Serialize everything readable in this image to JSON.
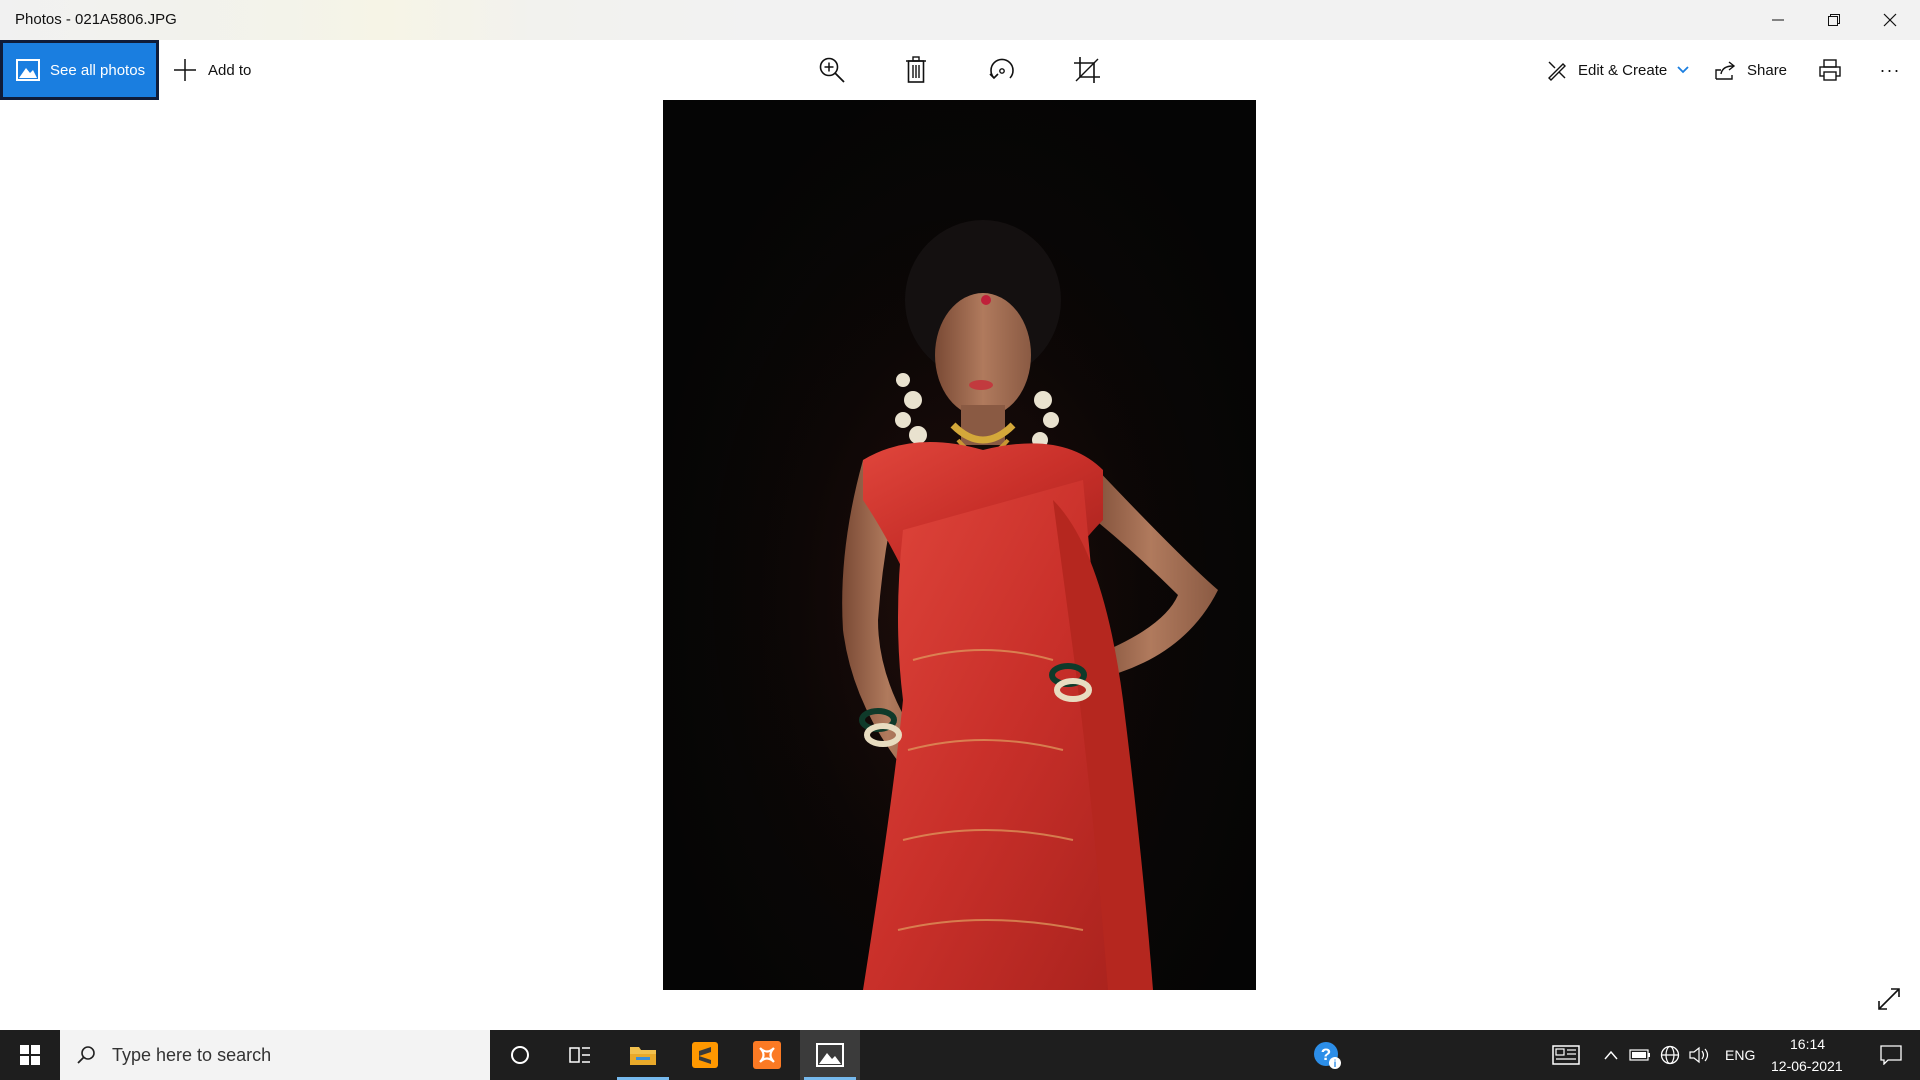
{
  "window": {
    "title": "Photos - 021A5806.JPG"
  },
  "toolbar": {
    "see_all_photos": "See all photos",
    "add_to": "Add to",
    "edit_create": "Edit & Create",
    "share": "Share",
    "more": "···"
  },
  "photo": {
    "subject": "Woman in red saree"
  },
  "taskbar": {
    "search_placeholder": "Type here to search",
    "language": "ENG",
    "time": "16:14",
    "date": "12-06-2021"
  },
  "colors": {
    "accent": "#1a7ee0",
    "taskbar": "#1e1e1e"
  }
}
